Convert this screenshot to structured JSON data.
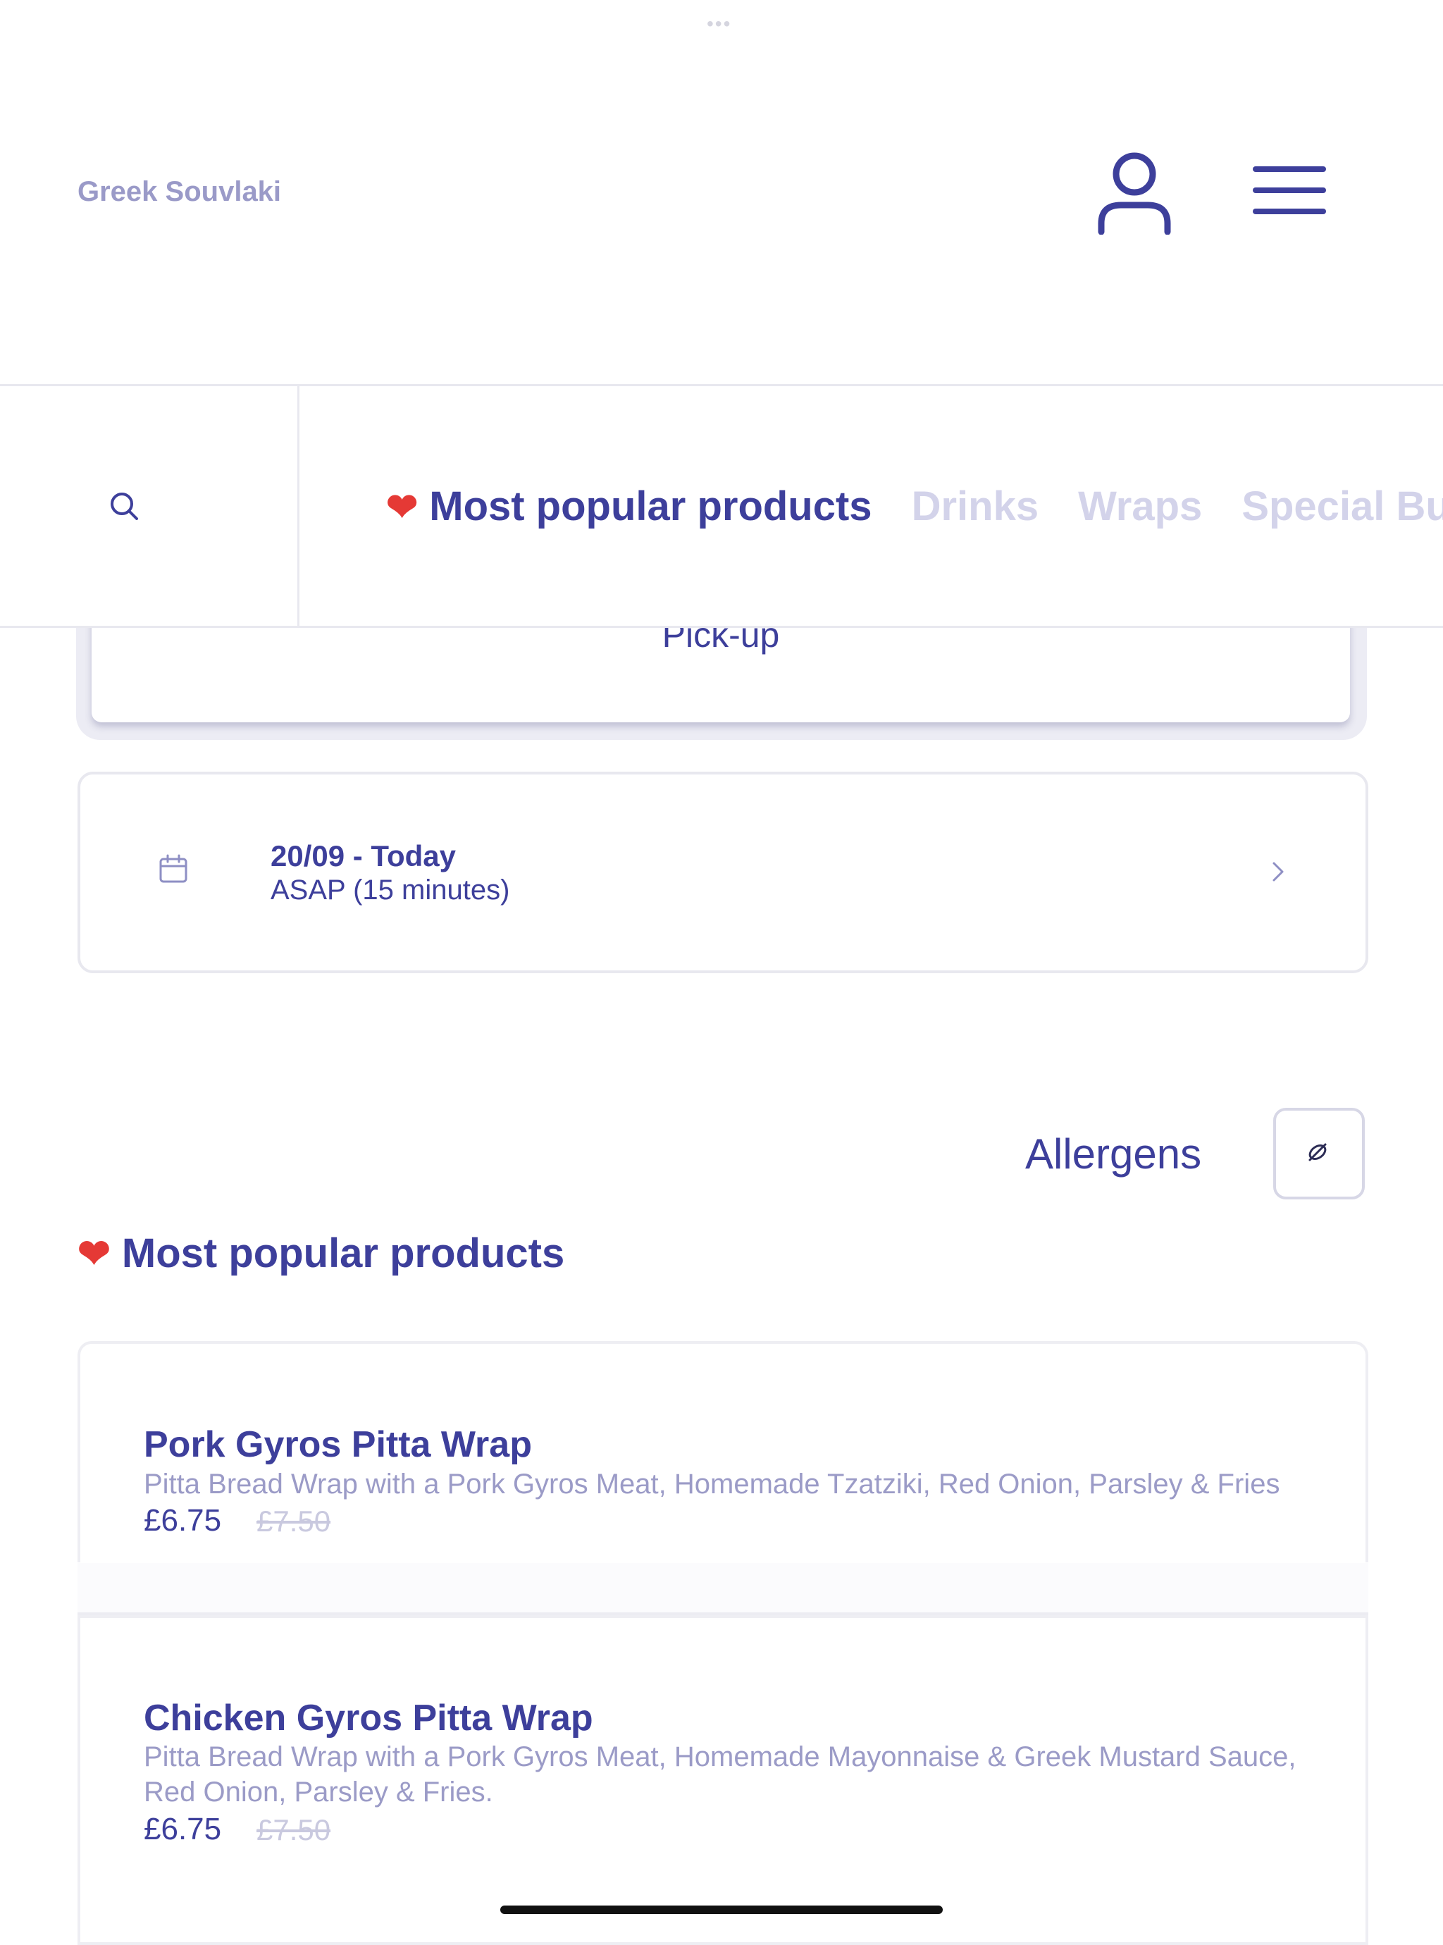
{
  "header": {
    "brand": "Greek Souvlaki",
    "icons": [
      "user-icon",
      "menu-icon"
    ]
  },
  "categories": {
    "items": [
      {
        "label": "Most popular products",
        "active": true
      },
      {
        "label": "Drinks",
        "active": false
      },
      {
        "label": "Wraps",
        "active": false
      },
      {
        "label": "Special Bu",
        "active": false
      }
    ]
  },
  "order": {
    "mode_label": "Pick-up",
    "date_title": "20/09 - Today",
    "date_subtitle": "ASAP (15 minutes)"
  },
  "allergens": {
    "label": "Allergens"
  },
  "section": {
    "title": "Most popular products"
  },
  "products": [
    {
      "name": "Pork Gyros Pitta Wrap",
      "description": "Pitta Bread Wrap with a Pork Gyros Meat, Homemade Tzatziki, Red Onion, Parsley & Fries",
      "price": "£6.75",
      "old_price": "£7.50"
    },
    {
      "name": "Chicken Gyros Pitta Wrap",
      "description": "Pitta Bread Wrap with a Pork Gyros Meat, Homemade Mayonnaise & Greek Mustard Sauce, Red Onion, Parsley & Fries.",
      "price": "£6.75",
      "old_price": "£7.50"
    }
  ],
  "colors": {
    "primary": "#3d3f9b",
    "muted": "#9b9bc7",
    "inactive_tab": "#d3d3ea",
    "border": "#e8e8ef"
  }
}
